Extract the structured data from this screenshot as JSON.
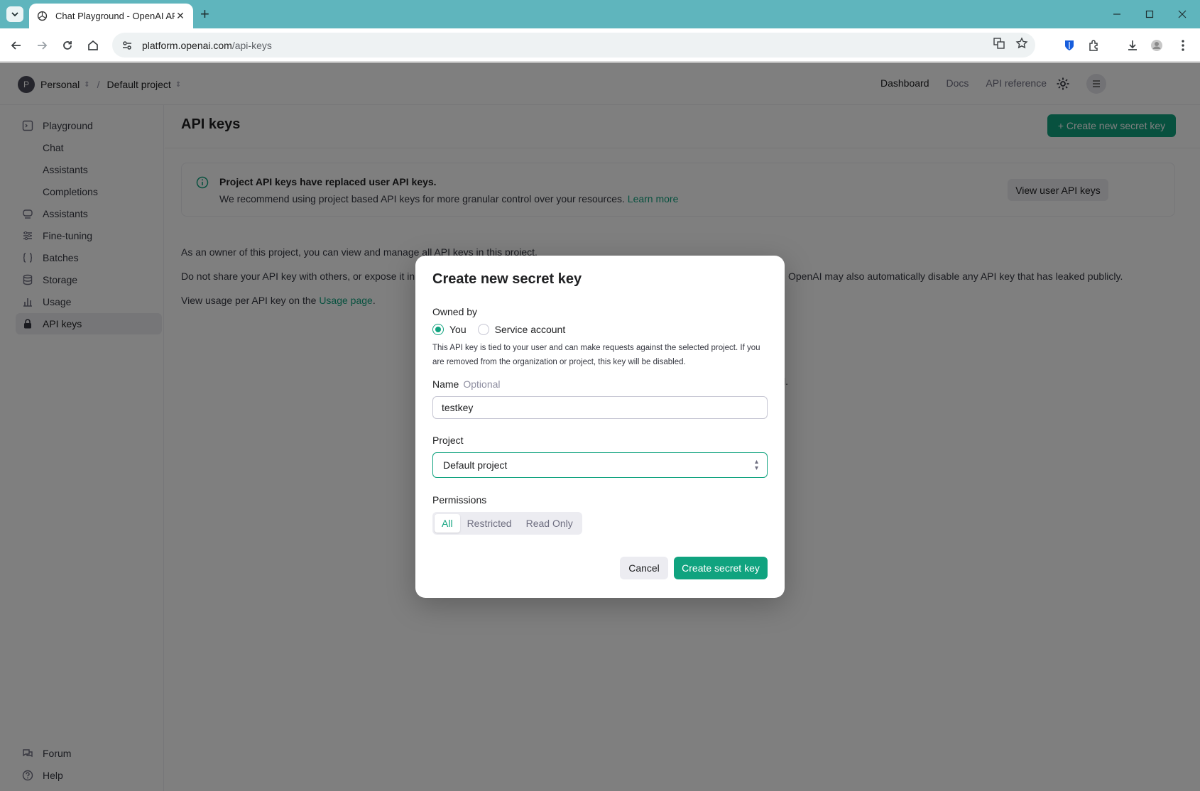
{
  "browser": {
    "tab_title": "Chat Playground - OpenAI API",
    "url_host": "platform.openai.com",
    "url_path": "/api-keys"
  },
  "topnav": {
    "org": "Personal",
    "org_initial": "P",
    "project": "Default project",
    "links": [
      "Dashboard",
      "Docs",
      "API reference"
    ]
  },
  "sidebar": {
    "items": [
      {
        "label": "Playground",
        "icon": "playground-icon"
      },
      {
        "label": "Chat"
      },
      {
        "label": "Assistants"
      },
      {
        "label": "Completions"
      },
      {
        "label": "Assistants",
        "icon": "assistants-icon"
      },
      {
        "label": "Fine-tuning",
        "icon": "fine-tuning-icon"
      },
      {
        "label": "Batches",
        "icon": "batches-icon"
      },
      {
        "label": "Storage",
        "icon": "storage-icon"
      },
      {
        "label": "Usage",
        "icon": "usage-icon"
      },
      {
        "label": "API keys",
        "icon": "lock-icon"
      }
    ],
    "footer": [
      {
        "label": "Forum",
        "icon": "forum-icon"
      },
      {
        "label": "Help",
        "icon": "help-icon"
      }
    ]
  },
  "main": {
    "title": "API keys",
    "create_button": "+ Create new secret key",
    "notice": {
      "title": "Project API keys have replaced user API keys.",
      "body": "We recommend using project based API keys for more granular control over your resources.",
      "link": "Learn more",
      "button": "View user API keys"
    },
    "para1": "As an owner of this project, you can view and manage all API keys in this project.",
    "para2_left": "Do not share your API key with others, or expose it in t",
    "para2_right": "OpenAI may also automatically disable any API key that has leaked publicly.",
    "para3_prefix": "View usage per API key on the",
    "para3_link": "Usage page",
    "para3_suffix": ".",
    "hidden_fragment": "l."
  },
  "modal": {
    "title": "Create new secret key",
    "owned_by_label": "Owned by",
    "owner_options": [
      "You",
      "Service account"
    ],
    "owner_selected": "You",
    "help_text": "This API key is tied to your user and can make requests against the selected project. If you are removed from the organization or project, this key will be disabled.",
    "name_label": "Name",
    "name_optional": "Optional",
    "name_value": "testkey",
    "project_label": "Project",
    "project_value": "Default project",
    "permissions_label": "Permissions",
    "permissions_options": [
      "All",
      "Restricted",
      "Read Only"
    ],
    "permissions_selected": "All",
    "cancel": "Cancel",
    "create": "Create secret key"
  },
  "colors": {
    "accent": "#10a37f",
    "tabbar": "#5fb5bd"
  }
}
